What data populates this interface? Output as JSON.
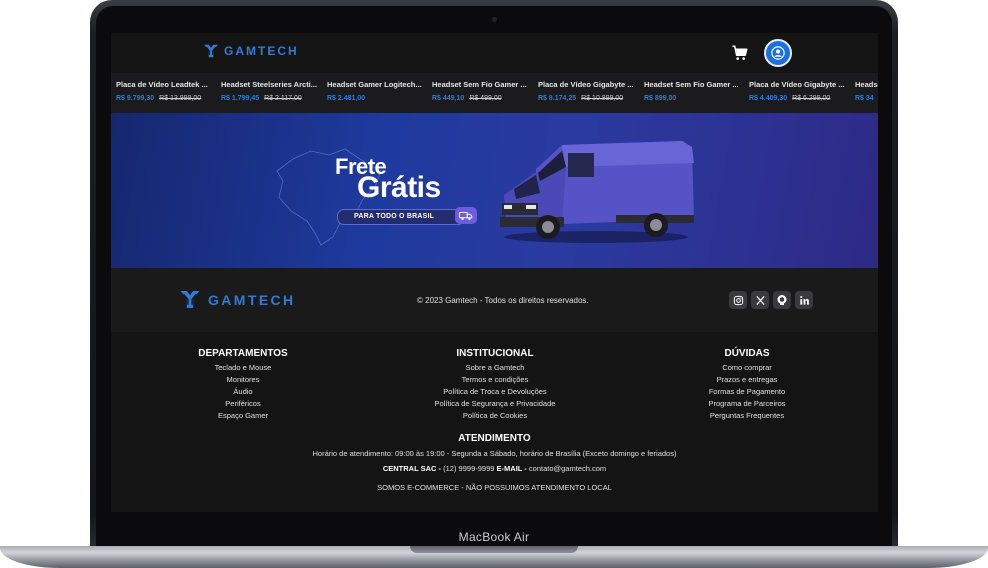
{
  "device": {
    "label": "MacBook Air"
  },
  "header": {
    "brand": "GAMTECH",
    "cart_icon": "cart-icon",
    "user_icon": "user-icon",
    "accent": "#2f7bd8"
  },
  "products": [
    {
      "name": "Placa de Vídeo Leadtek ...",
      "price": "R$ 9.799,30",
      "old_price": "R$ 13.999,00"
    },
    {
      "name": "Headset Steelseries Arcti...",
      "price": "R$ 1.799,45",
      "old_price": "R$ 2.117,00"
    },
    {
      "name": "Headset Gamer Logitech...",
      "price": "R$ 2.481,00",
      "old_price": ""
    },
    {
      "name": "Headset Sem Fio Gamer ...",
      "price": "R$ 449,10",
      "old_price": "R$ 499,00"
    },
    {
      "name": "Placa de Vídeo Gigabyte ...",
      "price": "R$ 8.174,25",
      "old_price": "R$ 10.899,00"
    },
    {
      "name": "Headset Sem Fio Gamer ...",
      "price": "R$ 899,00",
      "old_price": ""
    },
    {
      "name": "Placa de Vídeo Gigabyte ...",
      "price": "R$ 4.409,30",
      "old_price": "R$ 6.299,00"
    },
    {
      "name": "Headset",
      "price": "R$ 34",
      "old_price": ""
    }
  ],
  "banner": {
    "line1": "Frete",
    "line2": "Grátis",
    "pill": "PARA TODO O BRASIL",
    "badge_icon": "truck-icon"
  },
  "footer": {
    "brand": "GAMTECH",
    "copyright": "© 2023 Gamtech - Todos os direitos reservados.",
    "socials": [
      {
        "icon": "instagram-icon"
      },
      {
        "icon": "x-icon"
      },
      {
        "icon": "github-icon"
      },
      {
        "icon": "linkedin-icon"
      }
    ],
    "columns": [
      {
        "title": "DEPARTAMENTOS",
        "links": [
          "Teclado e Mouse",
          "Monitores",
          "Áudio",
          "Periféricos",
          "Espaço Gamer"
        ]
      },
      {
        "title": "INSTITUCIONAL",
        "links": [
          "Sobre a Gamtech",
          "Termos e condições",
          "Política de Troca e Devoluções",
          "Política de Segurança e Privacidade",
          "Política de Cookies"
        ]
      },
      {
        "title": "DÚVIDAS",
        "links": [
          "Como comprar",
          "Prazos e entregas",
          "Formas de Pagamento",
          "Programa de Parceiros",
          "Perguntas Frequentes"
        ]
      }
    ],
    "atendimento": {
      "title": "ATENDIMENTO",
      "hours": "Horário de atendimento: 09:00 às 19:00 - Segunda a Sábado, horário de Brasília (Exceto domingo e feriados)",
      "sac_label": "CENTRAL SAC -",
      "sac_value": "(12) 9999-9999",
      "email_label": "E-MAIL -",
      "email_value": "contato@gamtech.com",
      "note": "SOMOS E-COMMERCE - NÃO POSSUIMOS ATENDIMENTO LOCAL"
    }
  }
}
